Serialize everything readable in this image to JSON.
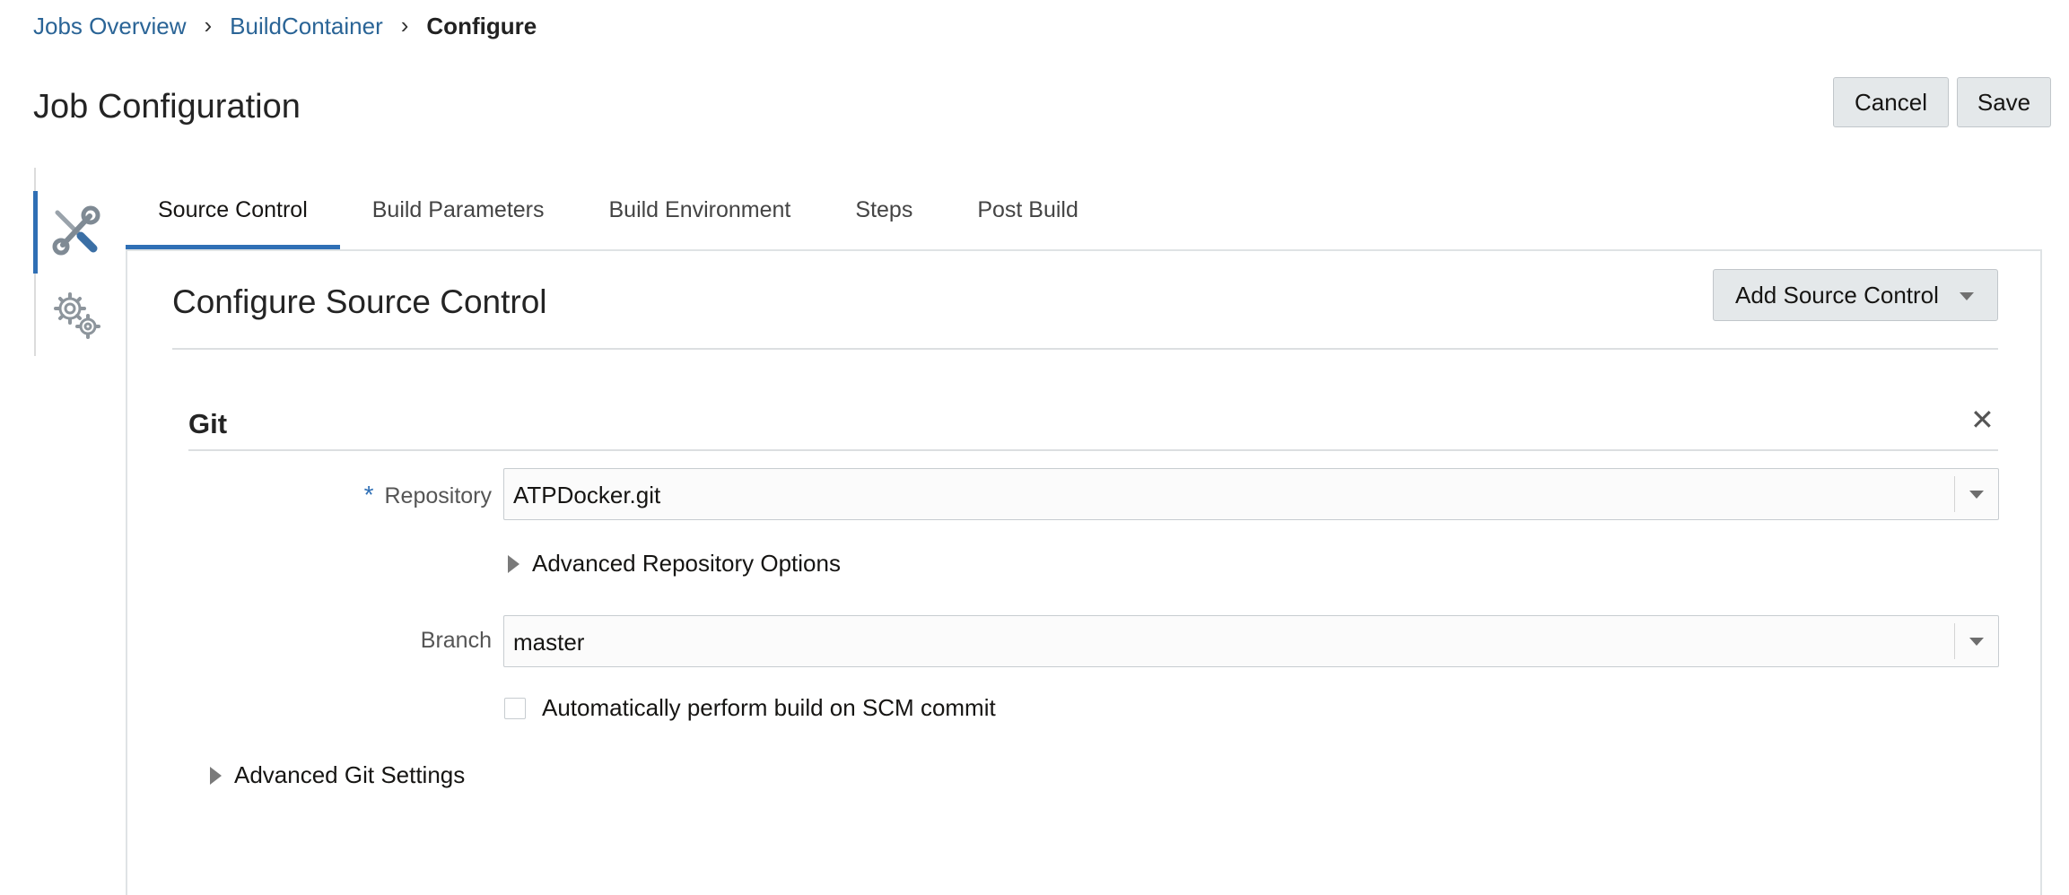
{
  "breadcrumb": {
    "items": [
      "Jobs Overview",
      "BuildContainer"
    ],
    "current": "Configure",
    "separator": "›"
  },
  "page": {
    "title": "Job Configuration"
  },
  "header_buttons": {
    "cancel": "Cancel",
    "save": "Save"
  },
  "side_nav": {
    "items": [
      {
        "icon": "tools-icon",
        "active": true
      },
      {
        "icon": "gears-icon",
        "active": false
      }
    ]
  },
  "tabs": [
    {
      "label": "Source Control",
      "active": true
    },
    {
      "label": "Build Parameters",
      "active": false
    },
    {
      "label": "Build Environment",
      "active": false
    },
    {
      "label": "Steps",
      "active": false
    },
    {
      "label": "Post Build",
      "active": false
    }
  ],
  "section": {
    "title": "Configure Source Control",
    "add_button": "Add Source Control"
  },
  "git": {
    "title": "Git",
    "close_symbol": "✕",
    "repository_label": "Repository",
    "required_marker": "*",
    "repository_value": "ATPDocker.git",
    "advanced_repo_options": "Advanced Repository Options",
    "branch_label": "Branch",
    "branch_value": "master",
    "auto_build_label": "Automatically perform build on SCM commit",
    "auto_build_checked": false,
    "advanced_git_settings": "Advanced Git Settings"
  },
  "colors": {
    "accent": "#2f6fb5",
    "link": "#2a6496",
    "button_bg": "#e4e8ea"
  }
}
